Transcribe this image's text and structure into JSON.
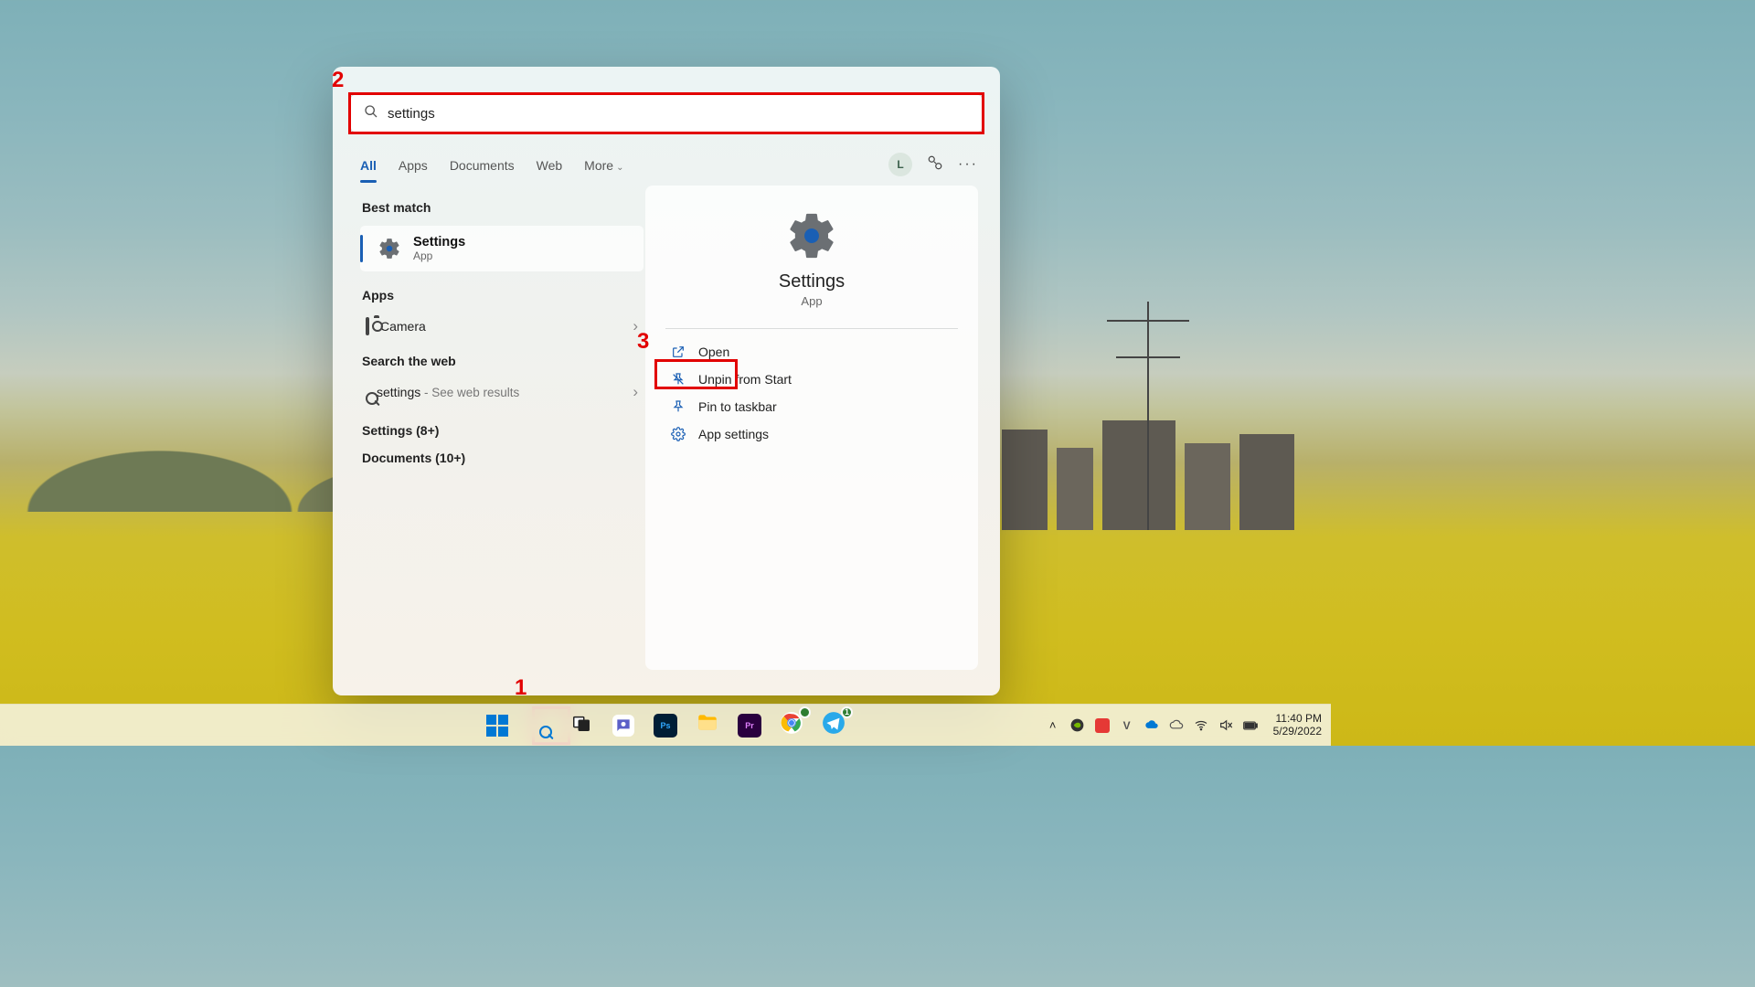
{
  "search": {
    "value": "settings"
  },
  "tabs": {
    "all": "All",
    "apps": "Apps",
    "documents": "Documents",
    "web": "Web",
    "more": "More"
  },
  "user": {
    "initial": "L"
  },
  "left": {
    "best_match_h": "Best match",
    "best": {
      "title": "Settings",
      "subtitle": "App"
    },
    "apps_h": "Apps",
    "camera": "Camera",
    "web_h": "Search the web",
    "web_term": "settings",
    "web_suffix": " - See web results",
    "settings_more": "Settings (8+)",
    "documents_more": "Documents (10+)"
  },
  "right": {
    "title": "Settings",
    "subtitle": "App",
    "open": "Open",
    "unpin": "Unpin from Start",
    "pin_taskbar": "Pin to taskbar",
    "app_settings": "App settings"
  },
  "annotations": {
    "n1": "1",
    "n2": "2",
    "n3": "3"
  },
  "taskbar": {
    "telegram_badge": "1"
  },
  "clock": {
    "time": "11:40 PM",
    "date": "5/29/2022"
  }
}
